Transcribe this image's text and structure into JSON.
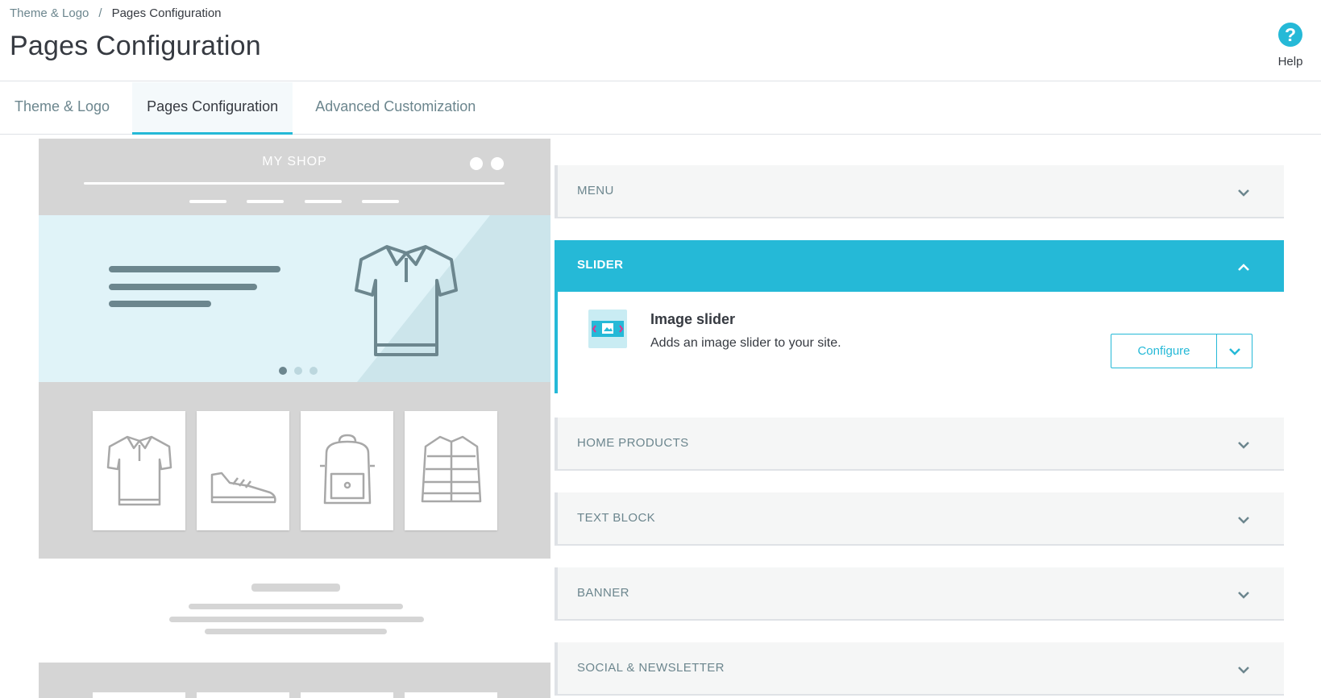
{
  "breadcrumb": {
    "parent": "Theme & Logo",
    "separator": "/",
    "current": "Pages Configuration"
  },
  "page_title": "Pages Configuration",
  "help": {
    "icon": "question-circle-icon",
    "label": "Help"
  },
  "tabs": [
    {
      "label": "Theme & Logo",
      "active": false
    },
    {
      "label": "Pages Configuration",
      "active": true
    },
    {
      "label": "Advanced Customization",
      "active": false
    }
  ],
  "preview": {
    "shop_name": "MY SHOP"
  },
  "panels": {
    "menu": "MENU",
    "slider": "SLIDER",
    "home_products": "HOME PRODUCTS",
    "text_block": "TEXT BLOCK",
    "banner": "BANNER",
    "social": "SOCIAL & NEWSLETTER"
  },
  "slider_module": {
    "name": "Image slider",
    "description": "Adds an image slider to your site.",
    "configure_label": "Configure"
  },
  "colors": {
    "accent": "#25b9d7",
    "text": "#363a41",
    "muted": "#6c868e",
    "panel_bg": "#f5f6f6",
    "preview_gray": "#d5d5d5"
  }
}
